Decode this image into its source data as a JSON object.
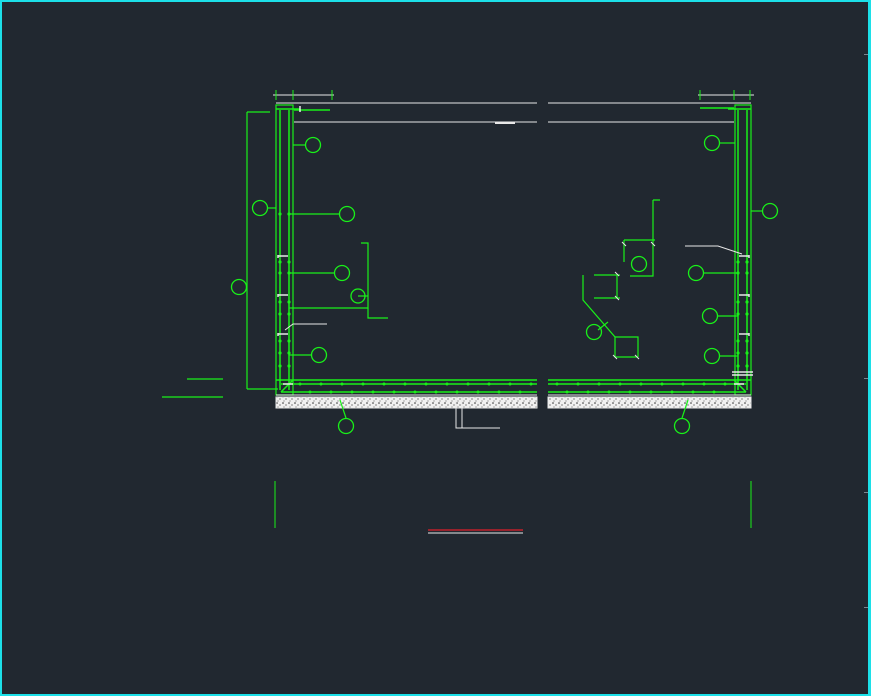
{
  "viewport": {
    "border_color": "#1ce0e8",
    "background": "#212830"
  },
  "colors": {
    "rebar": "#19f019",
    "dim": "#e8e8e8",
    "title_underline": "#c0202a",
    "concrete": "#d8d8d8",
    "tick": "#7c8590"
  },
  "drawing": {
    "callouts_left": [
      "",
      "",
      "",
      "",
      "",
      "",
      "",
      ""
    ],
    "callouts_right": [
      "",
      "",
      "",
      "",
      "",
      "",
      "",
      ""
    ],
    "title": ""
  }
}
